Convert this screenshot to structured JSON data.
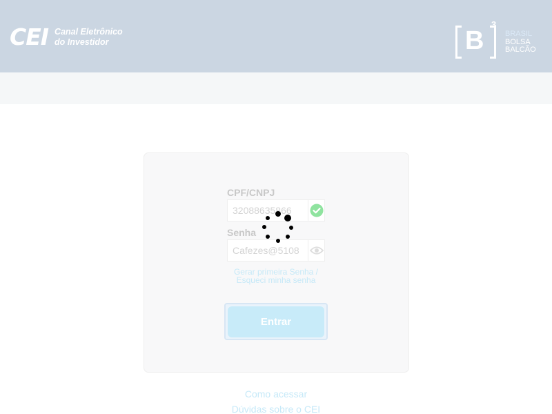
{
  "header": {
    "cei_mark": "CEI",
    "cei_line1": "Canal Eletrônico",
    "cei_line2": "do Investidor",
    "b3_letter": "B",
    "b3_sup": "3",
    "b3_line1": "BRASIL",
    "b3_line2": "BOLSA",
    "b3_line3": "BALCÃO"
  },
  "login": {
    "cpf_label": "CPF/CNPJ",
    "cpf_value": "32088635866",
    "password_label": "Senha",
    "password_value": "Cafezes@5108",
    "link_line1": "Gerar primeira Senha /",
    "link_line2": "Esqueci minha senha",
    "submit_label": "Entrar"
  },
  "footer": {
    "link1": "Como acessar",
    "link2": "Dúvidas sobre o CEI"
  },
  "icons": {
    "valid": "check-circle-icon",
    "reveal": "eye-icon",
    "loading": "loading-spinner"
  },
  "colors": {
    "header_bg": "#cbd6e2",
    "valid_green": "#8fe39f",
    "link_blue": "#c6e9f8",
    "button_bg": "#c8ebf9"
  }
}
